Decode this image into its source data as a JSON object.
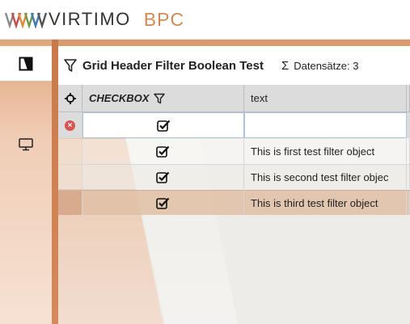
{
  "header": {
    "logo_word": "VIRTIMO",
    "logo_app": "BPC"
  },
  "sidebar": {
    "items": [
      {
        "icon": "grid-filter-app-icon",
        "active": true
      },
      {
        "icon": "monitor-icon",
        "active": false
      }
    ]
  },
  "panel": {
    "title": "Grid Header Filter Boolean Test",
    "sum_symbol": "Σ",
    "record_label": "Datensätze: 3"
  },
  "grid": {
    "columns": [
      {
        "label": "CHECKBOX"
      },
      {
        "label": "text"
      }
    ],
    "filter": {
      "checkbox": true,
      "text": ""
    },
    "rows": [
      {
        "checkbox": true,
        "text": "This is first test filter object"
      },
      {
        "checkbox": true,
        "text": "This is second test filter objec"
      },
      {
        "checkbox": true,
        "text": "This is third test filter object"
      }
    ]
  },
  "colors": {
    "accent": "#d18a55",
    "sidebar_edge": "#c9794a"
  }
}
